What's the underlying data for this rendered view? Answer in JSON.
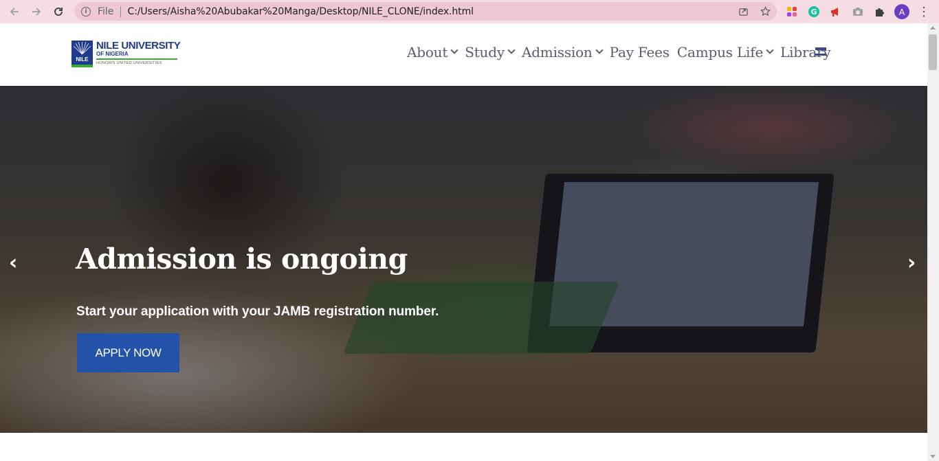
{
  "browser": {
    "file_label": "File",
    "url": "C:/Users/Aisha%20Abubakar%20Manga/Desktop/NILE_CLONE/index.html",
    "profile_initial": "A",
    "accent_color": "#f6dce3"
  },
  "logo": {
    "title": "NILE UNIVERSITY",
    "subtitle": "OF NIGERIA",
    "mark_text": "NILE",
    "tagline": "HONORIS UNITED UNIVERSITIES"
  },
  "nav": {
    "items": [
      {
        "label": "About",
        "dropdown": true
      },
      {
        "label": "Study",
        "dropdown": true
      },
      {
        "label": "Admission",
        "dropdown": true
      },
      {
        "label": "Pay Fees",
        "dropdown": false
      },
      {
        "label": "Campus Life",
        "dropdown": true
      },
      {
        "label": "Library",
        "dropdown": false
      }
    ]
  },
  "hero": {
    "title": "Admission is ongoing",
    "subtitle": "Start your application with your JAMB registration number.",
    "cta_label": "APPLY NOW",
    "prev_arrow": "‹",
    "next_arrow": "›",
    "cta_color": "#2452a8"
  }
}
